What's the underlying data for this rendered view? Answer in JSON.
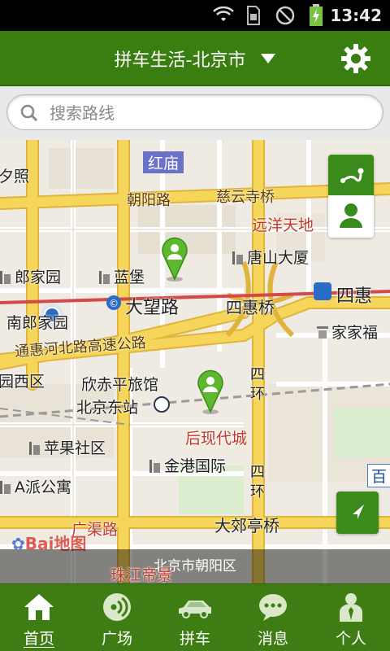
{
  "status_bar": {
    "time": "13:42",
    "icons": [
      "wifi-icon",
      "sim-icon",
      "no-signal-icon",
      "battery-charging-icon"
    ]
  },
  "header": {
    "title": "拼车生活-北京市",
    "dropdown_icon": "caret-down-icon",
    "settings_icon": "gear-icon"
  },
  "search": {
    "placeholder": "搜索路线",
    "icon": "search-icon"
  },
  "map": {
    "labels": {
      "hongmiao": "红庙",
      "xizhao": "夕照",
      "chaoyang_rd": "朝阳路",
      "ciyunsi_bridge": "慈云寺桥",
      "yuanyang": "远洋天地",
      "langjiayuan": "郎家园",
      "lanbao": "蓝堡",
      "tangshan": "唐山大厦",
      "dawanglu": "大望路",
      "sihui_bridge": "四惠桥",
      "sihui": "四惠",
      "nanlang": "南郎家园",
      "jiakangfu": "家家福",
      "tonghui_expressway": "通惠河北路高速公路",
      "yuanxiqu": "园西区",
      "xinchiping": "欣赤平旅馆",
      "bj_east_station": "北京东站",
      "houxian": "后现代城",
      "sihuan_1": "四",
      "sihuan_2": "环",
      "sihuan_3": "四",
      "sihuan_4": "环",
      "apple_community": "苹果社区",
      "jingang": "金港国际",
      "apai": "A派公寓",
      "guangqu_rd": "广渠路",
      "dajiaoting_bridge": "大郊亭桥",
      "zhujiang": "珠江帝景",
      "bai_edge": "百",
      "baidu_logo": "Bai地图"
    },
    "district": "北京市朝阳区",
    "controls": {
      "route_icon": "route-icon",
      "person_icon": "person-icon",
      "locate_icon": "locate-arrow-icon"
    },
    "colors": {
      "highway": "#f5d65a",
      "highway_edge": "#e0b43a",
      "road": "#ffffff",
      "metro": "#d24a4a",
      "pin": "#5cb82e"
    }
  },
  "bottom_nav": {
    "items": [
      {
        "label": "首页",
        "icon": "home-icon",
        "active": true
      },
      {
        "label": "广场",
        "icon": "broadcast-icon",
        "active": false
      },
      {
        "label": "拼车",
        "icon": "car-icon",
        "active": false
      },
      {
        "label": "消息",
        "icon": "message-icon",
        "active": false
      },
      {
        "label": "个人",
        "icon": "user-icon",
        "active": false
      }
    ]
  }
}
